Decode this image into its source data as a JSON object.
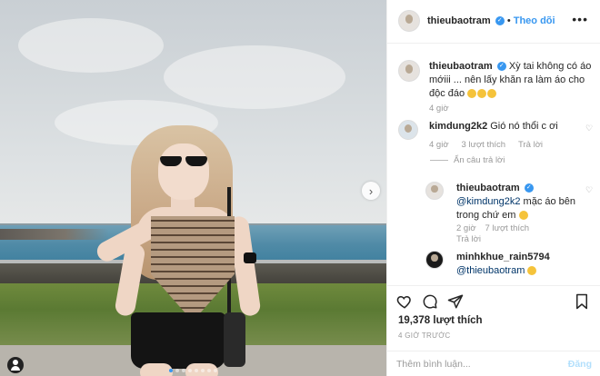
{
  "post": {
    "author": "thieubaotram",
    "follow_label": "Theo dõi",
    "caption": "Xỳ tai không có áo mớiii ... nên lấy khăn ra làm áo cho độc đáo",
    "caption_time": "4 giờ"
  },
  "comments": [
    {
      "user": "kimdung2k2",
      "text": "Gió nó thổi c ơi",
      "time": "4 giờ",
      "likes": "3 lượt thích",
      "reply_label": "Trả lời"
    }
  ],
  "hide_replies_label": "Ẩn câu trả lời",
  "replies": [
    {
      "user": "thieubaotram",
      "mention": "@kimdung2k2",
      "text": "mặc áo bên trong chứ em",
      "time": "2 giờ",
      "likes": "7 lượt thích",
      "reply_label": "Trả lời"
    },
    {
      "user": "minhkhue_rain5794",
      "mention": "@thieubaotram",
      "text": ""
    }
  ],
  "actions": {
    "like_count": "19,378 lượt thích",
    "timestamp": "4 GIỜ TRƯỚC"
  },
  "add_comment": {
    "placeholder": "Thêm bình luận...",
    "post_label": "Đăng"
  },
  "icons": {
    "heart": "heart-icon",
    "comment": "comment-icon",
    "share": "share-icon",
    "bookmark": "bookmark-icon",
    "more": "more-options-icon",
    "next": "chevron-right-icon",
    "user_tag": "user-tag-icon"
  },
  "colors": {
    "accent": "#3897f0",
    "text": "#262626",
    "muted": "#999999",
    "link": "#003569"
  }
}
